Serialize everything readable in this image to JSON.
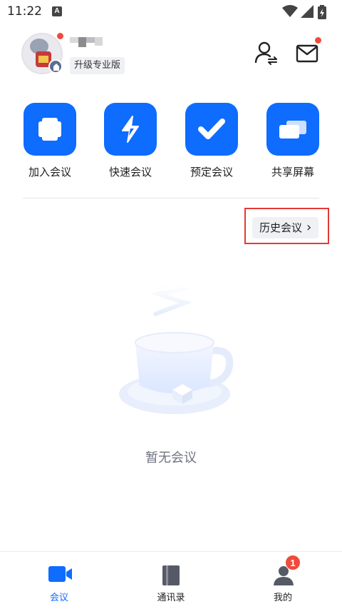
{
  "status_bar": {
    "time": "11:22",
    "notification_glyph": "A",
    "icons": [
      "wifi-icon",
      "signal-icon",
      "battery-icon"
    ]
  },
  "header": {
    "upgrade_label": "升级专业版",
    "has_unread_dot": true
  },
  "actions": [
    {
      "label": "加入会议",
      "icon": "plus-icon"
    },
    {
      "label": "快速会议",
      "icon": "lightning-icon"
    },
    {
      "label": "预定会议",
      "icon": "check-icon"
    },
    {
      "label": "共享屏幕",
      "icon": "share-screen-icon"
    }
  ],
  "history": {
    "label": "历史会议",
    "chevron": "›"
  },
  "empty_state": {
    "text": "暂无会议",
    "illustration": "coffee-cup-illustration"
  },
  "bottom_nav": {
    "items": [
      {
        "label": "会议",
        "icon": "video-camera-icon",
        "active": true
      },
      {
        "label": "通讯录",
        "icon": "address-book-icon",
        "active": false
      },
      {
        "label": "我的",
        "icon": "profile-icon",
        "active": false
      }
    ],
    "profile_badge": "1"
  },
  "colors": {
    "accent": "#0e6cff",
    "badge": "#f04a3c",
    "highlight_border": "#e53935"
  }
}
